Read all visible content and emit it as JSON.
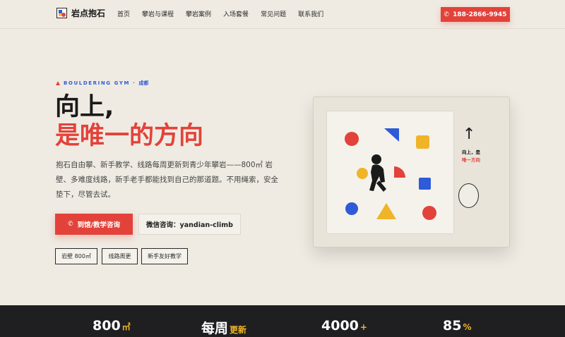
{
  "brand": {
    "name": "岩点抱石"
  },
  "nav": {
    "items": [
      "首页",
      "攀岩与课程",
      "攀岩案例",
      "入场套餐",
      "常见问题",
      "联系我们"
    ]
  },
  "header": {
    "phone_icon": "phone-icon",
    "phone": "188-2866-9945"
  },
  "hero": {
    "eyebrow_en": "BOULDERING GYM",
    "eyebrow_sep": "·",
    "eyebrow_city": "成都",
    "title_line1": "向上,",
    "title_line2": "是唯一的方向",
    "description": "抱石自由攀、新手教学、线路每周更新到青少年攀岩——800㎡ 岩壁、多难度线路，新手老手都能找到自己的那道题。不用绳索，安全垫下，尽管去试。",
    "cta_label": "到馆/教学咨询",
    "wechat_label": "微信咨询：yandian-climb",
    "tags": [
      "岩壁 800㎡",
      "线路周更",
      "新手友好教学"
    ]
  },
  "art": {
    "arrow": "↑",
    "side_text_1": "向上，是",
    "side_text_2": "唯一方向"
  },
  "stats": [
    {
      "value": "800",
      "suffix": "㎡"
    },
    {
      "value": "每周",
      "suffix": "更新"
    },
    {
      "value": "4000",
      "suffix": "+"
    },
    {
      "value": "85",
      "suffix": "%"
    }
  ],
  "colors": {
    "accent": "#e3423a",
    "blue": "#2f5bd8",
    "yellow": "#f0b429",
    "dark": "#1f1f22",
    "bg": "#efebe2"
  }
}
